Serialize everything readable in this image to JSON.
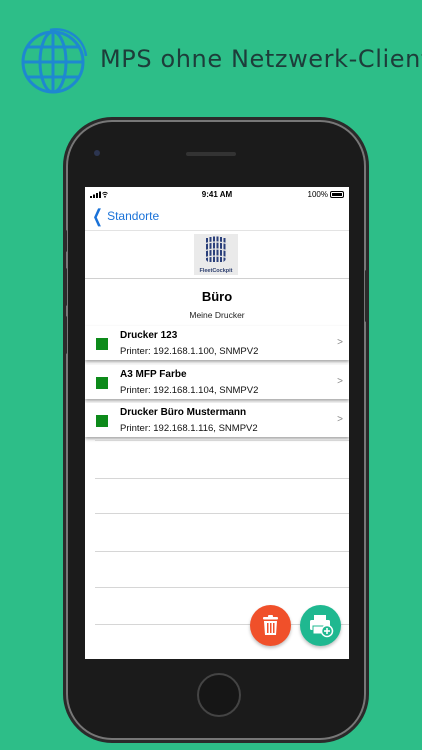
{
  "banner": {
    "title": "MPS ohne Netzwerk-Client",
    "icon": "globe-icon"
  },
  "status_bar": {
    "time": "9:41 AM",
    "battery": "100%"
  },
  "nav": {
    "back_label": "Standorte"
  },
  "logo": {
    "text": "FleetCockpit"
  },
  "location": {
    "title": "Büro",
    "subtitle": "Meine Drucker"
  },
  "printers": [
    {
      "name": "Drucker 123",
      "detail": "Printer: 192.168.1.100, SNMPV2",
      "status_color": "#0d8a1a"
    },
    {
      "name": "A3 MFP Farbe",
      "detail": "Printer: 192.168.1.104, SNMPV2",
      "status_color": "#0d8a1a"
    },
    {
      "name": "Drucker Büro Mustermann",
      "detail": "Printer: 192.168.1.116, SNMPV2",
      "status_color": "#0d8a1a"
    }
  ],
  "chevron": ">",
  "colors": {
    "background": "#2dbe88",
    "accent": "#1a72d8",
    "delete": "#f0502a",
    "add": "#1fb890"
  }
}
